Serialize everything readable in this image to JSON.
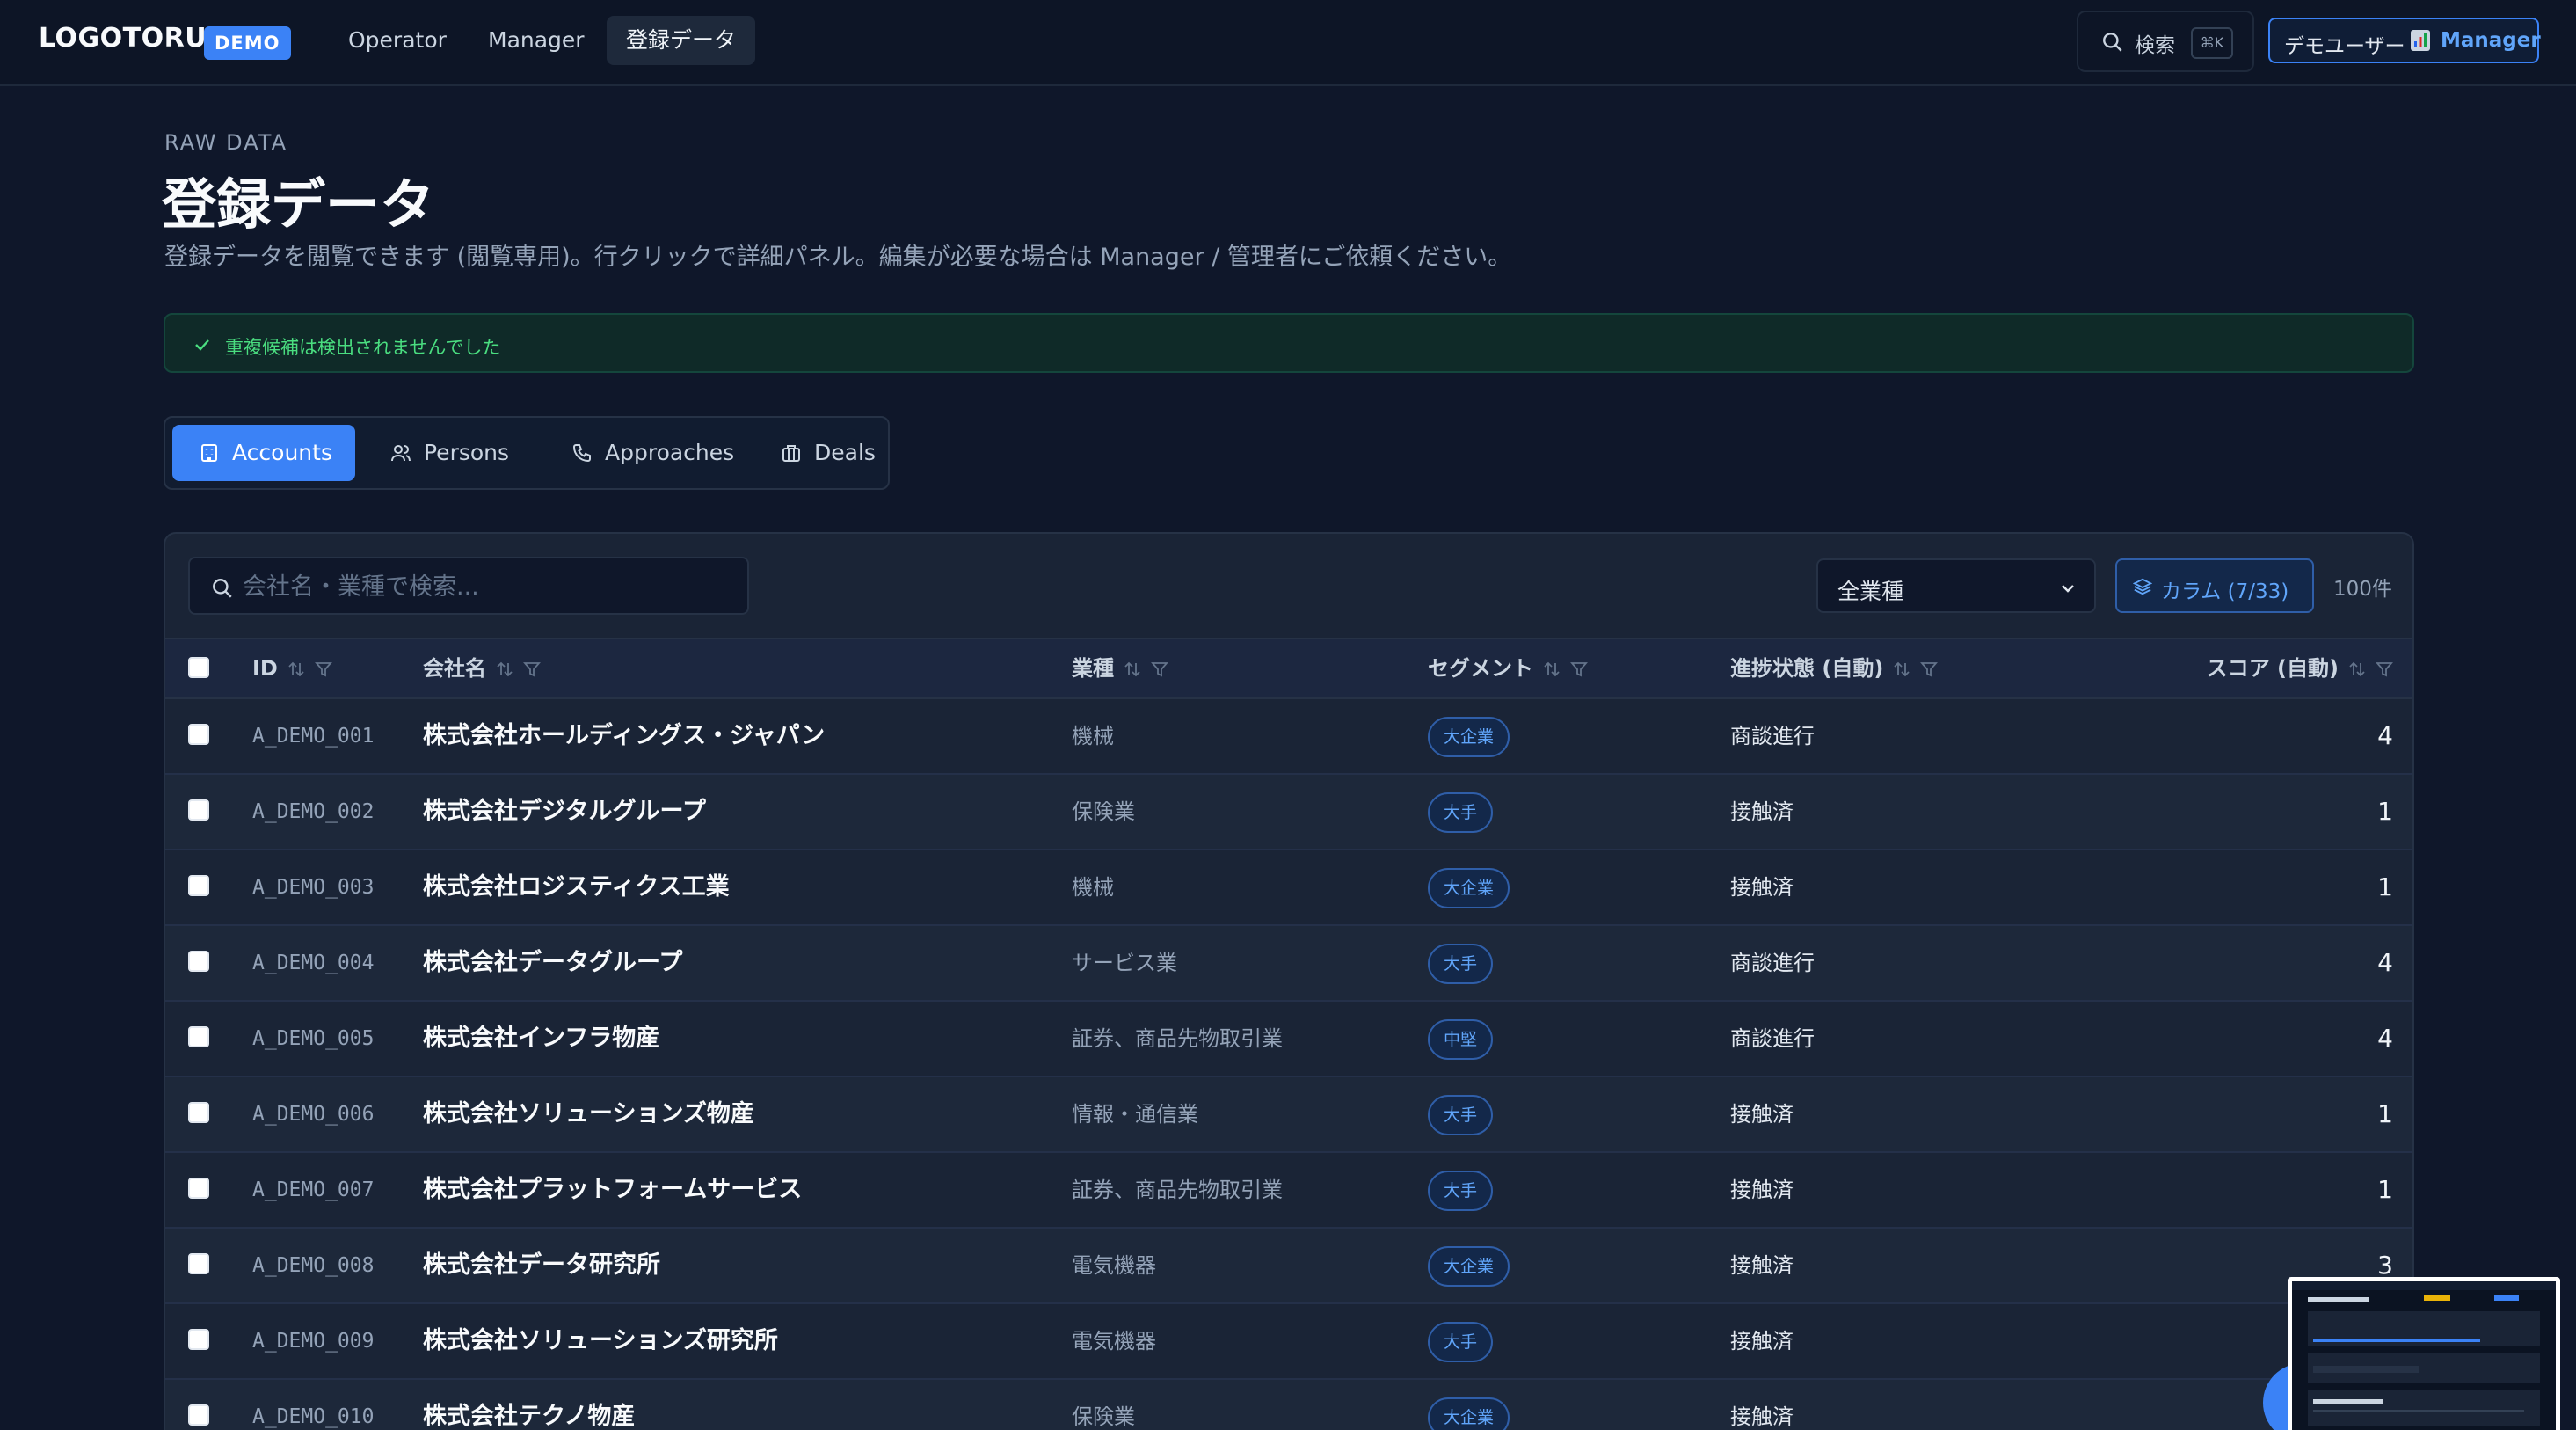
{
  "nav": {
    "logo": "LOGOTORU",
    "badge": "DEMO",
    "items": [
      "Operator",
      "Manager",
      "登録データ"
    ],
    "search_label": "検索",
    "search_kbd": "⌘K",
    "user_name": "デモユーザー",
    "user_role": "Manager"
  },
  "header": {
    "eyebrow": "RAW DATA",
    "title": "登録データ",
    "description": "登録データを閲覧できます (閲覧専用)。行クリックで詳細パネル。編集が必要な場合は Manager / 管理者にご依頼ください。"
  },
  "alert": {
    "message": "重複候補は検出されませんでした"
  },
  "tabs": [
    {
      "label": "Accounts",
      "icon": "building-icon",
      "active": true
    },
    {
      "label": "Persons",
      "icon": "users-icon",
      "active": false
    },
    {
      "label": "Approaches",
      "icon": "phone-icon",
      "active": false
    },
    {
      "label": "Deals",
      "icon": "briefcase-icon",
      "active": false
    }
  ],
  "toolbar": {
    "search_placeholder": "会社名・業種で検索...",
    "industry_filter": "全業種",
    "columns_label": "カラム (7/33)",
    "count": "100件"
  },
  "table": {
    "columns": [
      "ID",
      "会社名",
      "業種",
      "セグメント",
      "進捗状態 (自動)",
      "スコア (自動)"
    ],
    "rows": [
      {
        "id": "A_DEMO_001",
        "name": "株式会社ホールディングス・ジャパン",
        "industry": "機械",
        "segment": "大企業",
        "status": "商談進行",
        "score": "4"
      },
      {
        "id": "A_DEMO_002",
        "name": "株式会社デジタルグループ",
        "industry": "保険業",
        "segment": "大手",
        "status": "接触済",
        "score": "1"
      },
      {
        "id": "A_DEMO_003",
        "name": "株式会社ロジスティクス工業",
        "industry": "機械",
        "segment": "大企業",
        "status": "接触済",
        "score": "1"
      },
      {
        "id": "A_DEMO_004",
        "name": "株式会社データグループ",
        "industry": "サービス業",
        "segment": "大手",
        "status": "商談進行",
        "score": "4"
      },
      {
        "id": "A_DEMO_005",
        "name": "株式会社インフラ物産",
        "industry": "証券、商品先物取引業",
        "segment": "中堅",
        "status": "商談進行",
        "score": "4"
      },
      {
        "id": "A_DEMO_006",
        "name": "株式会社ソリューションズ物産",
        "industry": "情報・通信業",
        "segment": "大手",
        "status": "接触済",
        "score": "1"
      },
      {
        "id": "A_DEMO_007",
        "name": "株式会社プラットフォームサービス",
        "industry": "証券、商品先物取引業",
        "segment": "大手",
        "status": "接触済",
        "score": "1"
      },
      {
        "id": "A_DEMO_008",
        "name": "株式会社データ研究所",
        "industry": "電気機器",
        "segment": "大企業",
        "status": "接触済",
        "score": "3"
      },
      {
        "id": "A_DEMO_009",
        "name": "株式会社ソリューションズ研究所",
        "industry": "電気機器",
        "segment": "大手",
        "status": "接触済",
        "score": ""
      },
      {
        "id": "A_DEMO_010",
        "name": "株式会社テクノ物産",
        "industry": "保険業",
        "segment": "大企業",
        "status": "接触済",
        "score": ""
      }
    ]
  },
  "colors": {
    "background": "#0f172a",
    "accent": "#3b82f6",
    "success": "#4ade80"
  }
}
